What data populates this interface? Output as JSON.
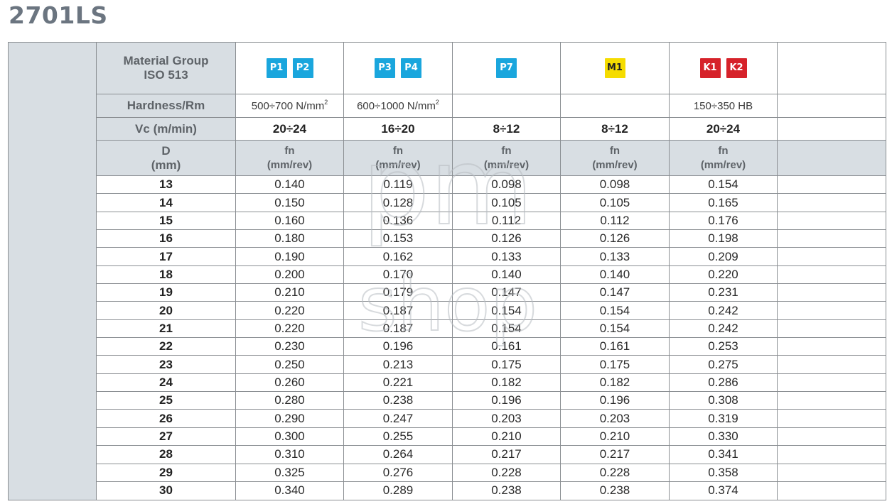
{
  "title": "2701LS",
  "header": {
    "material_group_line1": "Material Group",
    "material_group_line2": "ISO 513",
    "hardness_label": "Hardness/Rm",
    "vc_label": "Vc (m/min)",
    "d_label_line1": "D",
    "d_label_line2": "(mm)",
    "fn_line1": "fn",
    "fn_line2": "(mm/rev)"
  },
  "columns": [
    {
      "badges": [
        {
          "label": "P1",
          "color": "#1aa6dd"
        },
        {
          "label": "P2",
          "color": "#1aa6dd"
        }
      ],
      "hardness": "500÷700 N/mm",
      "hardness_sup": "2",
      "vc": "20÷24"
    },
    {
      "badges": [
        {
          "label": "P3",
          "color": "#1aa6dd"
        },
        {
          "label": "P4",
          "color": "#1aa6dd"
        }
      ],
      "hardness": "600÷1000 N/mm",
      "hardness_sup": "2",
      "vc": "16÷20"
    },
    {
      "badges": [
        {
          "label": "P7",
          "color": "#1aa6dd"
        }
      ],
      "hardness": "",
      "hardness_sup": "",
      "vc": "8÷12"
    },
    {
      "badges": [
        {
          "label": "M1",
          "color": "#f5dc00",
          "text_color": "#222222"
        }
      ],
      "hardness": "",
      "hardness_sup": "",
      "vc": "8÷12"
    },
    {
      "badges": [
        {
          "label": "K1",
          "color": "#d6222a"
        },
        {
          "label": "K2",
          "color": "#d6222a"
        }
      ],
      "hardness": "150÷350 HB",
      "hardness_sup": "",
      "vc": "20÷24"
    }
  ],
  "rows": [
    {
      "d": "13",
      "values": [
        "0.140",
        "0.119",
        "0.098",
        "0.098",
        "0.154"
      ]
    },
    {
      "d": "14",
      "values": [
        "0.150",
        "0.128",
        "0.105",
        "0.105",
        "0.165"
      ]
    },
    {
      "d": "15",
      "values": [
        "0.160",
        "0.136",
        "0.112",
        "0.112",
        "0.176"
      ]
    },
    {
      "d": "16",
      "values": [
        "0.180",
        "0.153",
        "0.126",
        "0.126",
        "0.198"
      ]
    },
    {
      "d": "17",
      "values": [
        "0.190",
        "0.162",
        "0.133",
        "0.133",
        "0.209"
      ]
    },
    {
      "d": "18",
      "values": [
        "0.200",
        "0.170",
        "0.140",
        "0.140",
        "0.220"
      ]
    },
    {
      "d": "19",
      "values": [
        "0.210",
        "0.179",
        "0.147",
        "0.147",
        "0.231"
      ]
    },
    {
      "d": "20",
      "values": [
        "0.220",
        "0.187",
        "0.154",
        "0.154",
        "0.242"
      ]
    },
    {
      "d": "21",
      "values": [
        "0.220",
        "0.187",
        "0.154",
        "0.154",
        "0.242"
      ]
    },
    {
      "d": "22",
      "values": [
        "0.230",
        "0.196",
        "0.161",
        "0.161",
        "0.253"
      ]
    },
    {
      "d": "23",
      "values": [
        "0.250",
        "0.213",
        "0.175",
        "0.175",
        "0.275"
      ]
    },
    {
      "d": "24",
      "values": [
        "0.260",
        "0.221",
        "0.182",
        "0.182",
        "0.286"
      ]
    },
    {
      "d": "25",
      "values": [
        "0.280",
        "0.238",
        "0.196",
        "0.196",
        "0.308"
      ]
    },
    {
      "d": "26",
      "values": [
        "0.290",
        "0.247",
        "0.203",
        "0.203",
        "0.319"
      ]
    },
    {
      "d": "27",
      "values": [
        "0.300",
        "0.255",
        "0.210",
        "0.210",
        "0.330"
      ]
    },
    {
      "d": "28",
      "values": [
        "0.310",
        "0.264",
        "0.217",
        "0.217",
        "0.341"
      ]
    },
    {
      "d": "29",
      "values": [
        "0.325",
        "0.276",
        "0.228",
        "0.228",
        "0.358"
      ]
    },
    {
      "d": "30",
      "values": [
        "0.340",
        "0.289",
        "0.238",
        "0.238",
        "0.374"
      ]
    }
  ],
  "watermark": {
    "line1": "pm",
    "line2": "shop"
  }
}
